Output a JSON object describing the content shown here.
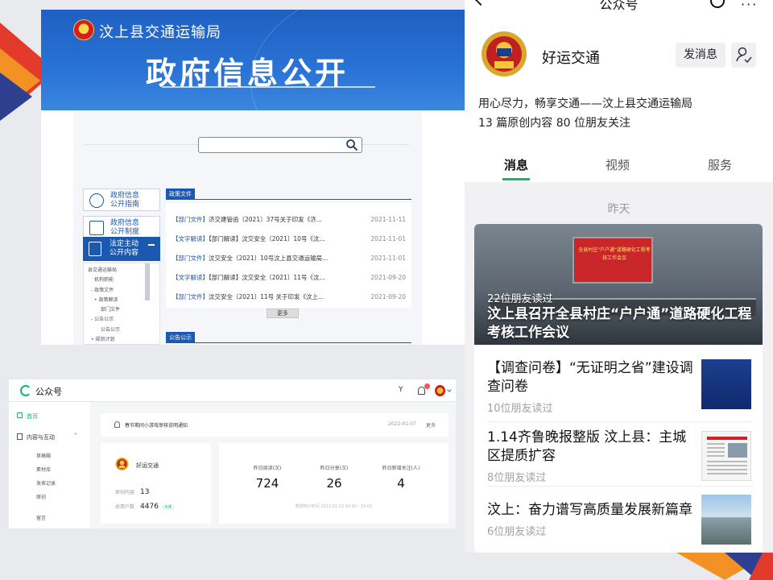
{
  "gov_portal": {
    "agency": "汶上县交通运输局",
    "title": "政府信息公开",
    "sidebar": [
      {
        "label1": "政府信息",
        "label2": "公开指南"
      },
      {
        "label1": "政府信息",
        "label2": "公开制度"
      },
      {
        "label1": "法定主动",
        "label2": "公开内容"
      }
    ],
    "tree": [
      "县交通运输局",
      "机构职能",
      "- 政策文件",
      "• 政策解读",
      "部门文件",
      "- 公告公示",
      "公告公示",
      "• 规划计划"
    ],
    "policy_section": "政策文件",
    "notice_section": "公告公示",
    "documents": [
      {
        "tag": "【部门文件】",
        "title": "济交建管函〔2021〕37号关于印发《济...",
        "date": "2021-11-11"
      },
      {
        "tag": "【文字解读】",
        "title": "【部门解读】汶交安全〔2021〕10号《汶...",
        "date": "2021-11-01"
      },
      {
        "tag": "【部门文件】",
        "title": "汶交安全〔2021〕10号汶上县交通运输局...",
        "date": "2021-11-01"
      },
      {
        "tag": "【文字解读】",
        "title": "【部门解读】汶交安全〔2021〕11号《汶...",
        "date": "2021-09-20"
      },
      {
        "tag": "【部门文件】",
        "title": "汶交安全〔2021〕11号 关于印发《汶上...",
        "date": "2021-09-20"
      }
    ],
    "more_label": "更多"
  },
  "wechat": {
    "header_title": "公众号",
    "account_name": "好运交通",
    "message_button": "发消息",
    "description": "用心尽力，畅享交通——汶上县交通运输局",
    "stats": "13 篇原创内容  80 位朋友关注",
    "tabs": [
      "消息",
      "视频",
      "服务"
    ],
    "date_label": "昨天",
    "hero_screen_text": "全县村庄\"户户通\"道路硬化工程考核工作会议",
    "hero": {
      "reads": "22位朋友读过",
      "title": "汶上县召开全县村庄“户户通”道路硬化工程考核工作会议"
    },
    "articles": [
      {
        "title": "【调查问卷】“无证明之省”建设调查问卷",
        "reads": "10位朋友读过"
      },
      {
        "title": "1.14齐鲁晚报整版 汶上县：主城区提质扩容",
        "reads": "8位朋友读过"
      },
      {
        "title": "汶上：奋力谱写高质量发展新篇章",
        "reads": "6位朋友读过"
      }
    ]
  },
  "mp_dashboard": {
    "brand": "公众号",
    "nav": {
      "home": "首页",
      "content": "内容与互动",
      "sub": [
        "草稿箱",
        "素材库",
        "发表记录",
        "原创"
      ],
      "comments": "留言"
    },
    "notice": {
      "text": "春节期间小游戏审核说明通知",
      "date": "2022-01-07",
      "more": "更多"
    },
    "account": {
      "name": "好运交通",
      "original_label": "原创内容",
      "original_value": "13",
      "users_label": "总用户数",
      "users_value": "4476",
      "users_delta": "+4"
    },
    "stats": [
      {
        "label": "昨日阅读(次)",
        "value": "724"
      },
      {
        "label": "昨日分享(次)",
        "value": "26"
      },
      {
        "label": "昨日新增关注(人)",
        "value": "4"
      }
    ],
    "stats_footer": "数据统计时间 2022.01.13 00:00 - 24:00",
    "top_icon_label": "Y"
  }
}
